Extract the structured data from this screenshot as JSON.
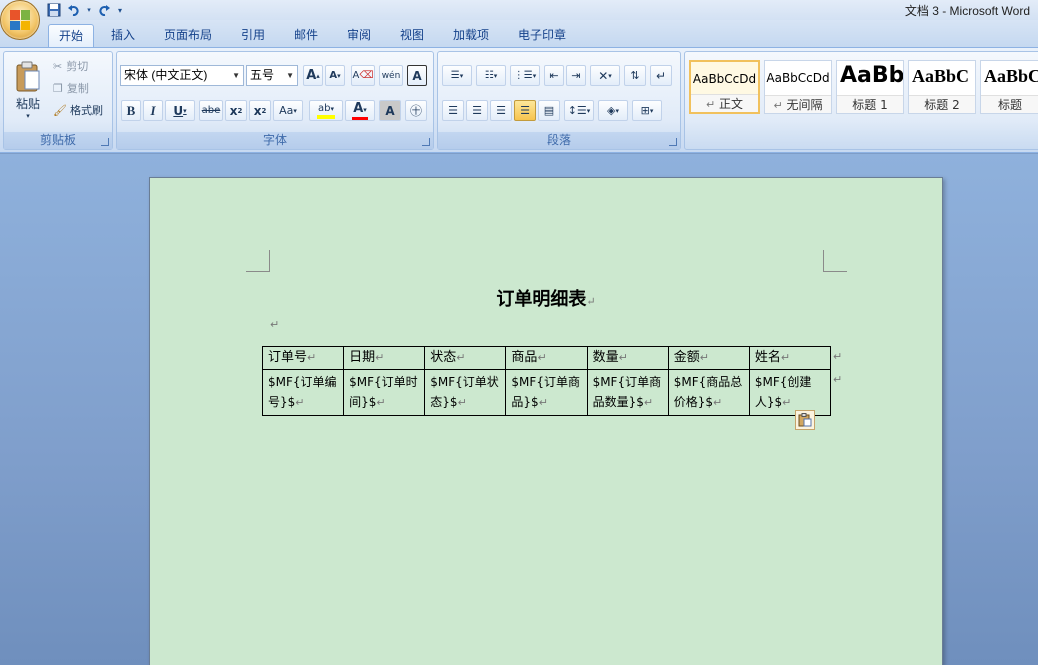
{
  "window": {
    "title": "文档 3 - Microsoft Word"
  },
  "quick_access": {
    "icons": [
      "save-icon",
      "undo-icon",
      "redo-icon",
      "customize-icon"
    ]
  },
  "tabs": [
    {
      "label": "开始",
      "active": true
    },
    {
      "label": "插入"
    },
    {
      "label": "页面布局"
    },
    {
      "label": "引用"
    },
    {
      "label": "邮件"
    },
    {
      "label": "审阅"
    },
    {
      "label": "视图"
    },
    {
      "label": "加载项"
    },
    {
      "label": "电子印章"
    }
  ],
  "clipboard": {
    "group_label": "剪贴板",
    "paste": "粘贴",
    "cut": "剪切",
    "copy": "复制",
    "format_painter": "格式刷"
  },
  "font": {
    "group_label": "字体",
    "font_name": "宋体 (中文正文)",
    "font_size": "五号"
  },
  "paragraph": {
    "group_label": "段落"
  },
  "styles": [
    {
      "sample": "AaBbCcDd",
      "name": "正文",
      "selected": true
    },
    {
      "sample": "AaBbCcDd",
      "name": "无间隔"
    },
    {
      "sample": "AaBb",
      "name": "标题 1"
    },
    {
      "sample": "AaBbC",
      "name": "标题 2"
    },
    {
      "sample": "AaBbC",
      "name": "标题"
    }
  ],
  "document": {
    "heading": "订单明细表",
    "para_mark": "↵",
    "table": {
      "headers": [
        "订单号",
        "日期",
        "状态",
        "商品",
        "数量",
        "金额",
        "姓名"
      ],
      "row": [
        "$MF{订单编号}$",
        "$MF{订单时间}$",
        "$MF{订单状态}$",
        "$MF{订单商品}$",
        "$MF{订单商品数量}$",
        "$MF{商品总价格}$",
        "$MF{创建人}$"
      ]
    }
  },
  "colors": {
    "page_background": "#cce8cf",
    "ribbon_accent": "#15428b",
    "highlight": "#ffff00",
    "font_color": "#ff0000"
  }
}
